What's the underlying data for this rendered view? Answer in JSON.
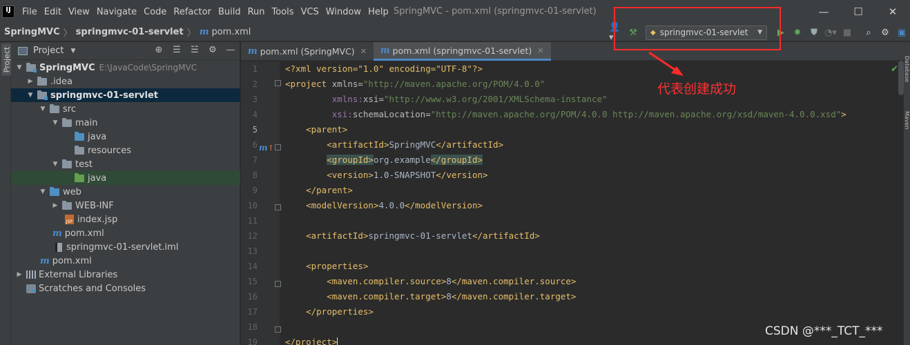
{
  "window": {
    "title": "SpringMVC - pom.xml (springmvc-01-servlet)",
    "logo": "IJ",
    "minimize": "—",
    "maximize": "☐",
    "close": "✕"
  },
  "menu": [
    "File",
    "Edit",
    "View",
    "Navigate",
    "Code",
    "Refactor",
    "Build",
    "Run",
    "Tools",
    "VCS",
    "Window",
    "Help"
  ],
  "breadcrumb": {
    "project": "SpringMVC",
    "module": "springmvc-01-servlet",
    "file": "pom.xml"
  },
  "toolbar": {
    "run_config": "springmvc-01-servlet",
    "icons": [
      "user-icon",
      "build-hammer-icon",
      "run-icon",
      "debug-icon",
      "coverage-icon",
      "profile-icon",
      "stop-icon",
      "search-icon",
      "settings-icon"
    ]
  },
  "project_panel": {
    "title": "Project",
    "side_label": "Project",
    "tree": [
      {
        "label": "SpringMVC",
        "path": "E:\\JavaCode\\SpringMVC"
      },
      {
        "label": ".idea"
      },
      {
        "label": "springmvc-01-servlet"
      },
      {
        "label": "src"
      },
      {
        "label": "main"
      },
      {
        "label": "java"
      },
      {
        "label": "resources"
      },
      {
        "label": "test"
      },
      {
        "label": "java"
      },
      {
        "label": "web"
      },
      {
        "label": "WEB-INF"
      },
      {
        "label": "index.jsp"
      },
      {
        "label": "pom.xml"
      },
      {
        "label": "springmvc-01-servlet.iml"
      },
      {
        "label": "pom.xml"
      },
      {
        "label": "External Libraries"
      },
      {
        "label": "Scratches and Consoles"
      }
    ]
  },
  "editor": {
    "tabs": [
      {
        "label": "pom.xml (SpringMVC)"
      },
      {
        "label": "pom.xml (springmvc-01-servlet)"
      }
    ],
    "line_numbers": [
      "1",
      "2",
      "3",
      "4",
      "5",
      "6",
      "7",
      "8",
      "9",
      "10",
      "11",
      "12",
      "13",
      "14",
      "15",
      "16",
      "17",
      "18",
      "19"
    ],
    "code": {
      "l1": {
        "decl": "<?xml version=\"1.0\" encoding=\"UTF-8\"?>"
      },
      "l2": {
        "open": "<project",
        "attr": " xmlns=",
        "val": "\"http://maven.apache.org/POM/4.0.0\""
      },
      "l3": {
        "ns": "xmlns:",
        "attr": "xsi=",
        "val": "\"http://www.w3.org/2001/XMLSchema-instance\""
      },
      "l4": {
        "ns": "xsi:",
        "attr": "schemaLocation=",
        "val": "\"http://maven.apache.org/POM/4.0.0 http://maven.apache.org/xsd/maven-4.0.0.xsd\"",
        "close": ">"
      },
      "l5": {
        "tag": "<parent>"
      },
      "l6": {
        "open": "<artifactId>",
        "text": "SpringMVC",
        "close": "</artifactId>"
      },
      "l7": {
        "open": "<groupId>",
        "text": "org.example",
        "close": "</groupId>"
      },
      "l8": {
        "open": "<version>",
        "text": "1.0-SNAPSHOT",
        "close": "</version>"
      },
      "l9": {
        "tag": "</parent>"
      },
      "l10": {
        "open": "<modelVersion>",
        "text": "4.0.0",
        "close": "</modelVersion>"
      },
      "l12": {
        "open": "<artifactId>",
        "text": "springmvc-01-servlet",
        "close": "</artifactId>"
      },
      "l14": {
        "tag": "<properties>"
      },
      "l15": {
        "open": "<maven.compiler.source>",
        "text": "8",
        "close": "</maven.compiler.source>"
      },
      "l16": {
        "open": "<maven.compiler.target>",
        "text": "8",
        "close": "</maven.compiler.target>"
      },
      "l17": {
        "tag": "</properties>"
      },
      "l19": {
        "tag": "</project>"
      }
    }
  },
  "right_strip": [
    "Database",
    "Maven"
  ],
  "annotation": {
    "text": "代表创建成功",
    "color": "#ff2a2a"
  },
  "watermark": "CSDN @***_TCT_***"
}
